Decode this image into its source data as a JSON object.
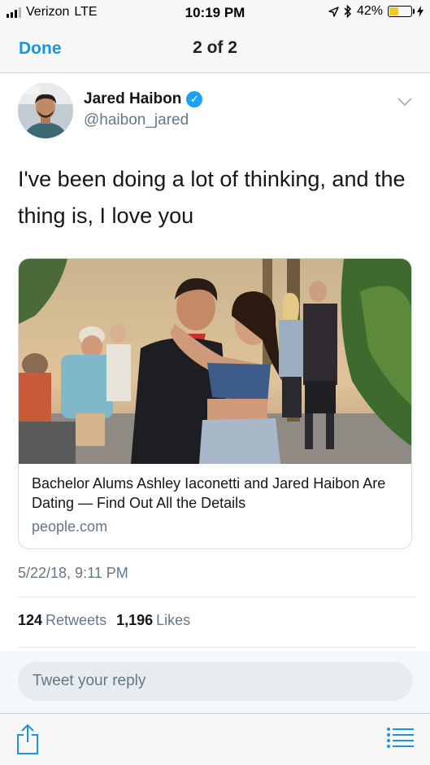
{
  "status_bar": {
    "carrier": "Verizon",
    "network": "LTE",
    "time": "10:19 PM",
    "battery_percent": "42%",
    "battery_level": 0.42,
    "icons": [
      "signal-icon",
      "location-icon",
      "bluetooth-icon",
      "battery-icon",
      "charging-icon"
    ]
  },
  "nav": {
    "done_label": "Done",
    "title": "2 of 2"
  },
  "tweet": {
    "author_name": "Jared Haibon",
    "handle": "@haibon_jared",
    "verified": true,
    "text": "I've been doing a lot of thinking, and the thing is, I love you",
    "timestamp": "5/22/18, 9:11 PM",
    "retweets_count": "124",
    "retweets_label": "Retweets",
    "likes_count": "1,196",
    "likes_label": "Likes"
  },
  "card": {
    "title": "Bachelor Alums Ashley Iaconetti and Jared Haibon Are Dating — Find Out All the Details",
    "domain": "people.com"
  },
  "reply": {
    "placeholder": "Tweet your reply"
  },
  "colors": {
    "accent": "#1b95e0",
    "verified": "#1da1f2",
    "secondary_text": "#657786",
    "battery": "#f5cc14"
  }
}
